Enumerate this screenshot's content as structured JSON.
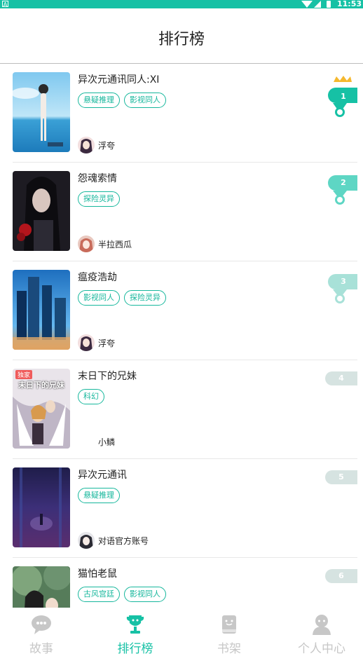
{
  "status_bar": {
    "time": "11:53",
    "left_badge": "A"
  },
  "header": {
    "title": "排行榜"
  },
  "colors": {
    "accent": "#16c1a5",
    "tag": "#16b79c",
    "inactive": "#c7c7c7",
    "rank_top": "#5ed6c4",
    "rank_mid": "#a8e1d8",
    "rank_gray": "#d6e3e1"
  },
  "items": [
    {
      "rank": "1",
      "title": "异次元通讯同人:XI",
      "tags": [
        "悬疑推理",
        "影视同人"
      ],
      "author": "浮夸",
      "cover": "sea-girl",
      "avatar": "dark-hair"
    },
    {
      "rank": "2",
      "title": "怨魂索情",
      "tags": [
        "探险灵异"
      ],
      "author": "半拉西瓜",
      "cover": "dark-girl",
      "avatar": "pink-hair"
    },
    {
      "rank": "3",
      "title": "瘟疫浩劫",
      "tags": [
        "影视同人",
        "探险灵异"
      ],
      "author": "浮夸",
      "cover": "city-night",
      "avatar": "dark-hair"
    },
    {
      "rank": "4",
      "title": "末日下的兄妹",
      "tags": [
        "科幻"
      ],
      "author": "小鳞",
      "cover": "angels",
      "avatar": "none",
      "cover_badge": "独家",
      "cover_title": "末日下的兄妹"
    },
    {
      "rank": "5",
      "title": "异次元通讯",
      "tags": [
        "悬疑推理"
      ],
      "author": "对语官方账号",
      "cover": "purple-alley",
      "avatar": "official"
    },
    {
      "rank": "6",
      "title": "猫怕老鼠",
      "tags": [
        "古风宫廷",
        "影视同人"
      ],
      "author": "",
      "cover": "forest-couple",
      "avatar": "none"
    }
  ],
  "tabs": [
    {
      "label": "故事",
      "icon": "chat-bubble-icon",
      "active": false
    },
    {
      "label": "排行榜",
      "icon": "trophy-icon",
      "active": true
    },
    {
      "label": "书架",
      "icon": "bookshelf-icon",
      "active": false
    },
    {
      "label": "个人中心",
      "icon": "person-icon",
      "active": false
    }
  ]
}
